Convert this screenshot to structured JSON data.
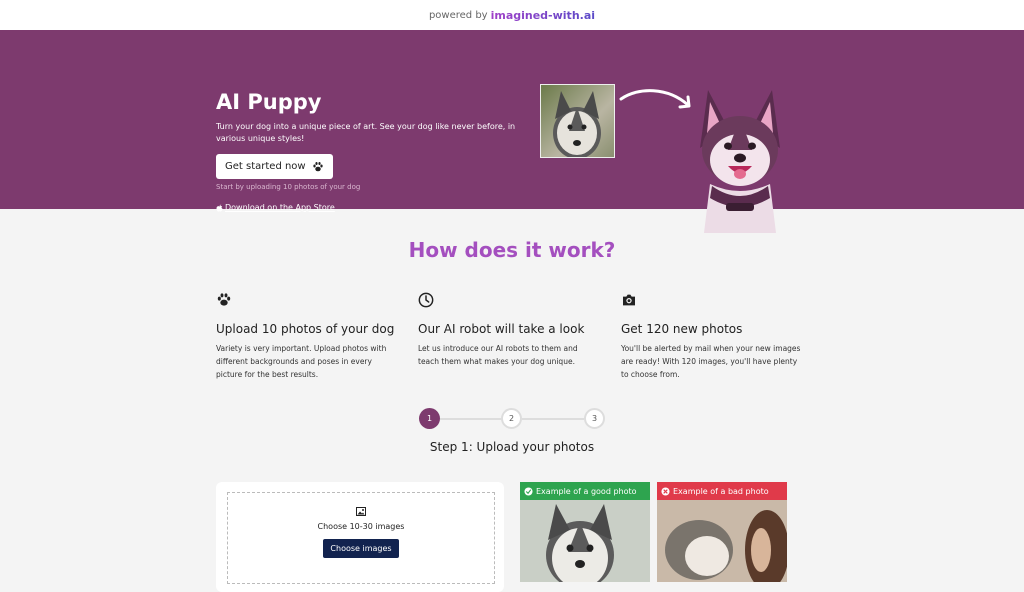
{
  "topbar": {
    "powered_by": "powered by",
    "brand": "imagined-with.ai"
  },
  "hero": {
    "title": "AI Puppy",
    "subtitle": "Turn your dog into a unique piece of art. See your dog like never before, in various unique styles!",
    "cta_label": "Get started now",
    "cta_note": "Start by uploading 10 photos of your dog",
    "appstore_label": "Download on the App Store"
  },
  "how": {
    "heading": "How does it work?",
    "features": [
      {
        "icon": "paw-icon",
        "title": "Upload 10 photos of your dog",
        "text": "Variety is very important. Upload photos with different backgrounds and poses in every picture for the best results."
      },
      {
        "icon": "clock-icon",
        "title": "Our AI robot will take a look",
        "text": "Let us introduce our AI robots to them and teach them what makes your dog unique."
      },
      {
        "icon": "camera-icon",
        "title": "Get 120 new photos",
        "text": "You'll be alerted by mail when your new images are ready! With 120 images, you'll have plenty to choose from."
      }
    ]
  },
  "stepper": {
    "steps": [
      "1",
      "2",
      "3"
    ],
    "active": 1,
    "title": "Step 1: Upload your photos"
  },
  "upload": {
    "choose_text": "Choose 10-30 images",
    "button_label": "Choose images"
  },
  "examples": {
    "good": {
      "label": "Example of a good photo",
      "color": "#2ea44f"
    },
    "bad": {
      "label": "Example of a bad photo",
      "color": "#e03a4a"
    }
  },
  "colors": {
    "hero_bg": "#7d3a6e",
    "heading": "#a44fbf",
    "button_dark": "#12234f"
  }
}
